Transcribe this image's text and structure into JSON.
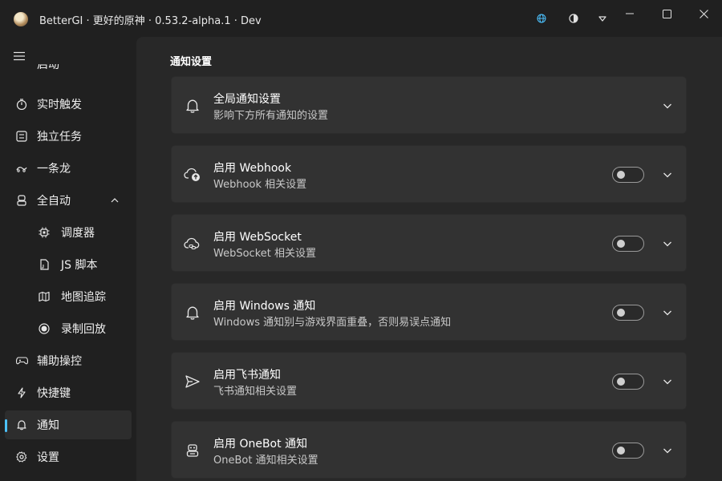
{
  "titlebar": {
    "title": "BetterGI · 更好的原神 · 0.53.2-alpha.1 · Dev",
    "icons": [
      "globe-icon",
      "contrast-icon",
      "dropdown-icon"
    ],
    "accent": "#4cc2ff"
  },
  "sidebar": {
    "partial_item": "启动",
    "items": [
      {
        "label": "实时触发",
        "icon": "timer-icon"
      },
      {
        "label": "独立任务",
        "icon": "task-list-icon"
      },
      {
        "label": "一条龙",
        "icon": "dragon-icon"
      },
      {
        "label": "全自动",
        "icon": "robot-icon",
        "expanded": true
      },
      {
        "label": "调度器",
        "icon": "chip-icon",
        "sub": true
      },
      {
        "label": "JS 脚本",
        "icon": "script-file-icon",
        "sub": true
      },
      {
        "label": "地图追踪",
        "icon": "map-icon",
        "sub": true
      },
      {
        "label": "录制回放",
        "icon": "record-icon",
        "sub": true
      },
      {
        "label": "辅助操控",
        "icon": "gamepad-icon"
      },
      {
        "label": "快捷键",
        "icon": "lightning-icon"
      },
      {
        "label": "通知",
        "icon": "bell-icon",
        "active": true
      },
      {
        "label": "设置",
        "icon": "gear-icon"
      }
    ]
  },
  "main": {
    "section_title": "通知设置",
    "cards": [
      {
        "title": "全局通知设置",
        "desc": "影响下方所有通知的设置",
        "icon": "bell-icon",
        "has_toggle": false
      },
      {
        "title": "启用 Webhook",
        "desc": "Webhook 相关设置",
        "icon": "cloud-upload-icon",
        "has_toggle": true,
        "enabled": false
      },
      {
        "title": "启用 WebSocket",
        "desc": "WebSocket 相关设置",
        "icon": "cloud-link-icon",
        "has_toggle": true,
        "enabled": false
      },
      {
        "title": "启用 Windows 通知",
        "desc": "Windows 通知别与游戏界面重叠，否则易误点通知",
        "icon": "bell-icon",
        "has_toggle": true,
        "enabled": false
      },
      {
        "title": "启用飞书通知",
        "desc": "飞书通知相关设置",
        "icon": "send-icon",
        "has_toggle": true,
        "enabled": false
      },
      {
        "title": "启用 OneBot 通知",
        "desc": "OneBot 通知相关设置",
        "icon": "bot-icon",
        "has_toggle": true,
        "enabled": false
      }
    ]
  }
}
